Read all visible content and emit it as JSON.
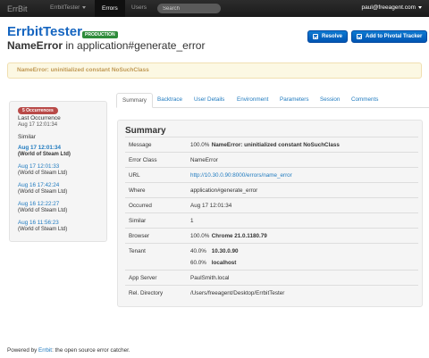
{
  "nav": {
    "brand": "ErrBit",
    "app_menu": "ErrbitTester",
    "items": [
      "Errors",
      "Users"
    ],
    "search_placeholder": "Search",
    "user": "paul@freeagent.com"
  },
  "header": {
    "app_name": "ErrbitTester",
    "environment": "PRODUCTION",
    "error_class": "NameError",
    "error_in": "in application#generate_error",
    "resolve_label": "Resolve",
    "tracker_label": "Add to Pivotal Tracker"
  },
  "alert": "NameError: uninitialized constant NoSuchClass",
  "sidebar": {
    "occurrences": "5 Occurrences",
    "last_occurrence_label": "Last Occurrence",
    "last_occurrence_value": "Aug 17 12:01:34",
    "similar_label": "Similar",
    "similar": [
      {
        "date": "Aug 17 12:01:34",
        "where": "(World of Steam Ltd)"
      },
      {
        "date": "Aug 17 12:01:33",
        "where": "(World of Steam Ltd)"
      },
      {
        "date": "Aug 16 17:42:24",
        "where": "(World of Steam Ltd)"
      },
      {
        "date": "Aug 16 12:22:27",
        "where": "(World of Steam Ltd)"
      },
      {
        "date": "Aug 16 11:56:23",
        "where": "(World of Steam Ltd)"
      }
    ]
  },
  "tabs": [
    "Summary",
    "Backtrace",
    "User Details",
    "Environment",
    "Parameters",
    "Session",
    "Comments"
  ],
  "summary": {
    "title": "Summary",
    "message_label": "Message",
    "message_pct": "100.0%",
    "message_value": "NameError: uninitialized constant NoSuchClass",
    "error_class_label": "Error Class",
    "error_class_value": "NameError",
    "url_label": "URL",
    "url_value": "http://10.30.0.90:8000/errors/name_error",
    "where_label": "Where",
    "where_value": "application#generate_error",
    "occurred_label": "Occurred",
    "occurred_value": "Aug 17 12:01:34",
    "similar_label": "Similar",
    "similar_value": "1",
    "browser_label": "Browser",
    "browser_pct": "100.0%",
    "browser_value": "Chrome 21.0.1180.79",
    "tenant_label": "Tenant",
    "tenant_pct1": "40.0%",
    "tenant_val1": "10.30.0.90",
    "tenant_pct2": "60.0%",
    "tenant_val2": "localhost",
    "app_server_label": "App Server",
    "app_server_value": "PaulSmith.local",
    "rel_dir_label": "Rel. Directory",
    "rel_dir_value": "/Users/freeagent/Desktop/ErrbitTester"
  },
  "footer": {
    "prefix": "Powered by",
    "link": "Errbit",
    "suffix": ": the open source error catcher."
  }
}
